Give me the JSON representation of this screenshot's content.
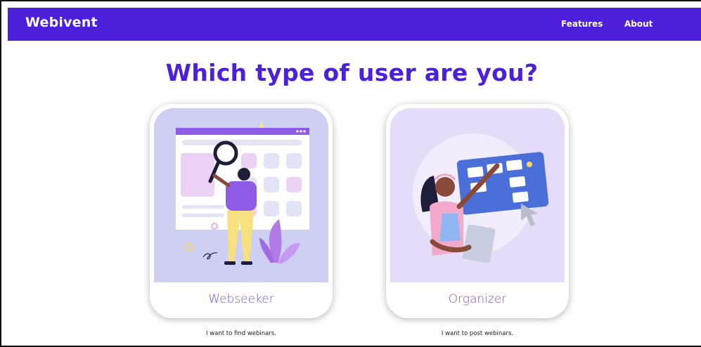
{
  "navbar": {
    "brand": "Webivent",
    "links": [
      {
        "label": "Features"
      },
      {
        "label": "About"
      }
    ],
    "color": "#4c1fd9"
  },
  "heading": "Which type of user are you?",
  "cards": [
    {
      "label": "Webseeker",
      "caption": "I want to find webinars.",
      "illustration": "magnifier-person-illustration"
    },
    {
      "label": "Organizer",
      "caption": "I want to post webinars.",
      "illustration": "woman-board-illustration"
    }
  ],
  "colors": {
    "accent": "#4c1fd9",
    "card_label": "#7b52d6"
  }
}
